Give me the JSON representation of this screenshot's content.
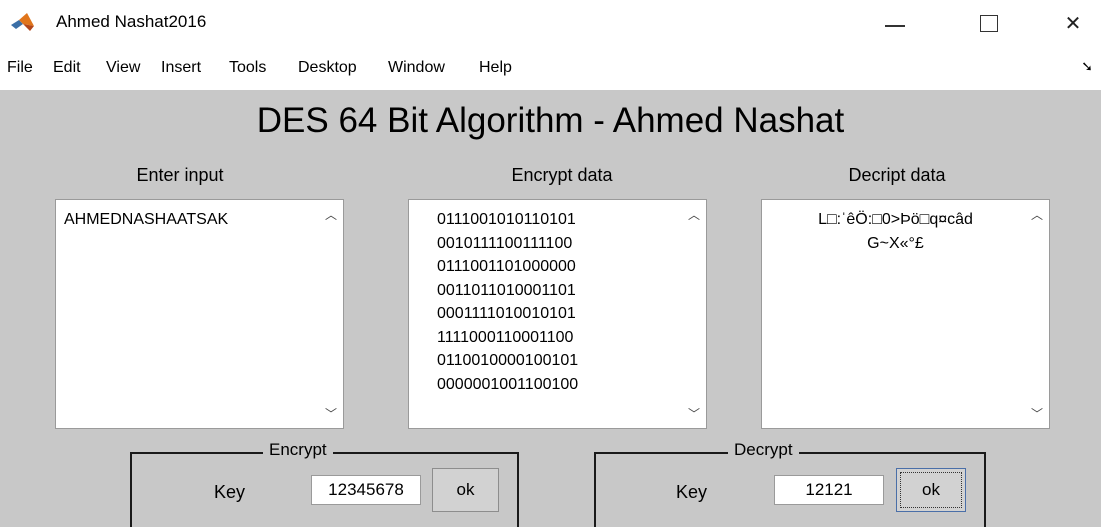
{
  "window": {
    "title": "Ahmed Nashat2016"
  },
  "menu": {
    "items": [
      "File",
      "Edit",
      "View",
      "Insert",
      "Tools",
      "Desktop",
      "Window",
      "Help"
    ]
  },
  "main": {
    "title": "DES 64 Bit Algorithm - Ahmed Nashat",
    "input_label": "Enter input",
    "encrypt_label": "Encrypt data",
    "decrypt_label": "Decript data",
    "input_value": "AHMEDNASHAATSAK",
    "encrypt_lines": [
      "0111001010110101",
      "0010111100111100",
      "0111001101000000",
      "0011011010001101",
      "0001111010010101",
      "1111000110001100",
      "0110010000100101",
      "0000001001100100"
    ],
    "decrypt_lines": [
      "L□:ˈêÖ:□0>Þö□q¤câd",
      "G~X«°£"
    ]
  },
  "encrypt_panel": {
    "title": "Encrypt",
    "key_label": "Key",
    "key_value": "12345678",
    "ok_label": "ok"
  },
  "decrypt_panel": {
    "title": "Decrypt",
    "key_label": "Key",
    "key_value": "12121",
    "ok_label": "ok"
  },
  "icons": {
    "app": "matlab-logo-icon",
    "minimize": "minimize-icon",
    "maximize": "maximize-icon",
    "close": "close-icon",
    "scroll_up": "chevron-up-icon",
    "scroll_down": "chevron-down-icon"
  }
}
